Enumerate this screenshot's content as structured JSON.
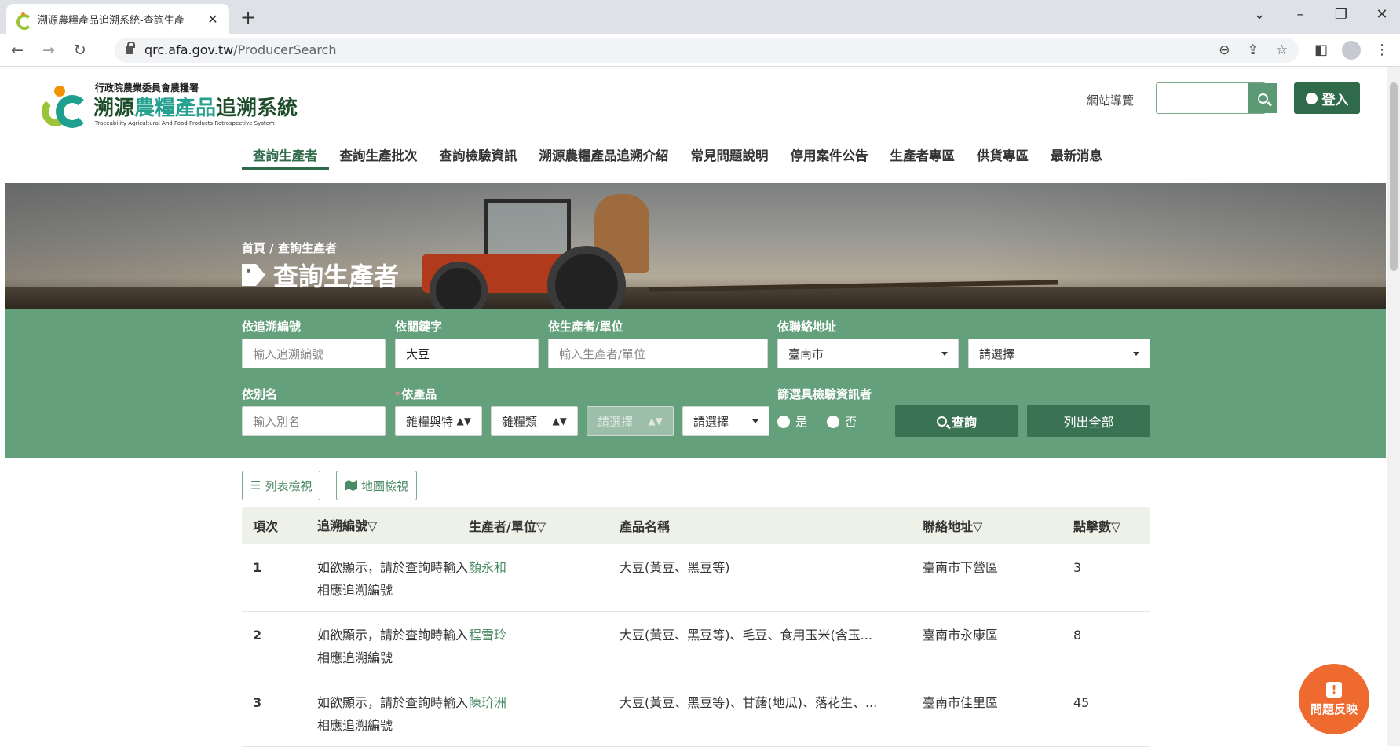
{
  "browser": {
    "tab_title": "溯源農糧產品追溯系統-查詢生產",
    "url_host": "qrc.afa.gov.tw",
    "url_path": "/ProducerSearch"
  },
  "header": {
    "org": "行政院農業委員會農糧署",
    "system_name_1": "溯源",
    "system_name_2": "農糧產品",
    "system_name_3": "追溯系統",
    "system_name_en": "Traceability Agricultural And Food Products Retrospective System",
    "sitemap": "網站導覽",
    "login": "登入"
  },
  "nav": [
    "查詢生產者",
    "查詢生產批次",
    "查詢檢驗資訊",
    "溯源農糧產品追溯介紹",
    "常見問題說明",
    "停用案件公告",
    "生產者專區",
    "供貨專區",
    "最新消息"
  ],
  "banner": {
    "breadcrumb_home": "首頁",
    "breadcrumb_sep": "/",
    "breadcrumb_current": "查詢生產者",
    "title": "查詢生產者"
  },
  "filters": {
    "trace_label": "依追溯編號",
    "trace_placeholder": "輸入追溯編號",
    "keyword_label": "依關鍵字",
    "keyword_value": "大豆",
    "producer_label": "依生產者/單位",
    "producer_placeholder": "輸入生產者/單位",
    "address_label": "依聯絡地址",
    "city_value": "臺南市",
    "district_value": "請選擇",
    "alias_label": "依別名",
    "alias_placeholder": "輸入別名",
    "product_required": "*",
    "product_label": "依產品",
    "product_sel1": "雜糧與特",
    "product_sel2": "雜糧類",
    "product_sel3": "請選擇",
    "product_sel4": "請選擇",
    "inspect_label": "篩選具檢驗資訊者",
    "radio_yes": "是",
    "radio_no": "否",
    "search_btn": "查詢",
    "list_all_btn": "列出全部"
  },
  "view": {
    "list": "列表檢視",
    "map": "地圖檢視"
  },
  "table": {
    "headers": [
      "項次",
      "追溯編號▽",
      "生產者/單位▽",
      "產品名稱",
      "聯絡地址▽",
      "點擊數▽"
    ],
    "rows": [
      {
        "no": "1",
        "trace": "如欲顯示，請於查詢時輸入相應追溯編號",
        "producer": "顏永和",
        "product": "大豆(黃豆、黑豆等)",
        "address": "臺南市下營區",
        "clicks": "3"
      },
      {
        "no": "2",
        "trace": "如欲顯示，請於查詢時輸入相應追溯編號",
        "producer": "程雪玲",
        "product": "大豆(黃豆、黑豆等)、毛豆、食用玉米(含玉...",
        "address": "臺南市永康區",
        "clicks": "8"
      },
      {
        "no": "3",
        "trace": "如欲顯示，請於查詢時輸入相應追溯編號",
        "producer": "陳玠洲",
        "product": "大豆(黃豆、黑豆等)、甘藷(地瓜)、落花生、...",
        "address": "臺南市佳里區",
        "clicks": "45"
      }
    ]
  },
  "feedback": "問題反映"
}
